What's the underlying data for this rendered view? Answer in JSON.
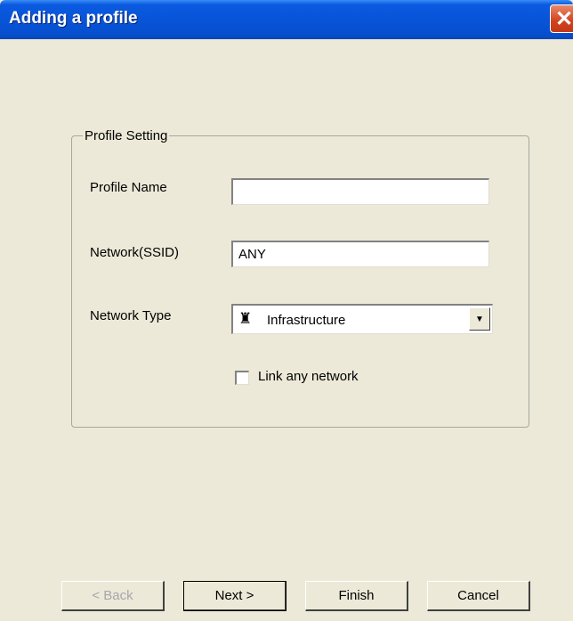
{
  "window": {
    "title": "Adding a profile",
    "close_glyph": "✕"
  },
  "group": {
    "legend": "Profile Setting",
    "profile_name": {
      "label": "Profile Name",
      "value": ""
    },
    "ssid": {
      "label": "Network(SSID)",
      "value": "ANY"
    },
    "network_type": {
      "label": "Network Type",
      "value": "Infrastructure",
      "icon": "infrastructure-icon",
      "icon_glyph": "♜",
      "arrow": "▼"
    },
    "link_any": {
      "label": "Link any network",
      "checked": false
    }
  },
  "buttons": {
    "back": "< Back",
    "next": "Next >",
    "finish": "Finish",
    "cancel": "Cancel"
  }
}
